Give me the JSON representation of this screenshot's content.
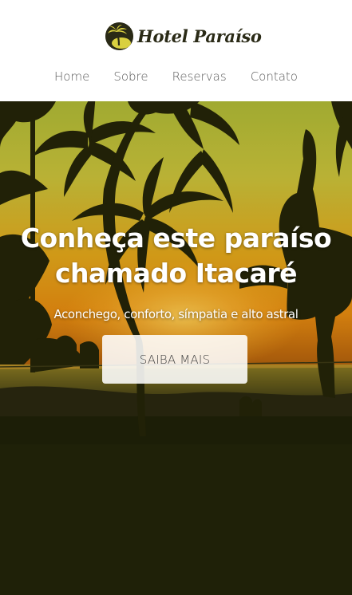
{
  "brand": {
    "name": "Hotel Paraíso",
    "logo_icon": "palm-tree-icon"
  },
  "nav": {
    "items": [
      {
        "label": "Home"
      },
      {
        "label": "Sobre"
      },
      {
        "label": "Reservas"
      },
      {
        "label": "Contato"
      }
    ]
  },
  "hero": {
    "title_line1": "Conheça este paraíso",
    "title_line2": "chamado Itacaré",
    "subtitle": "Aconchego, conforto, símpatia e alto astral",
    "button_label": "SAIBA MAIS"
  },
  "colors": {
    "header_bg": "#ffffff",
    "logo_dark": "#2a2a16",
    "logo_accent": "#d9d040",
    "nav_text": "#5a5a5a",
    "sky_top": "#b9c23a",
    "sky_mid": "#e4a817",
    "sunset_orange": "#e58a10",
    "page_bg": "#1f2108"
  }
}
